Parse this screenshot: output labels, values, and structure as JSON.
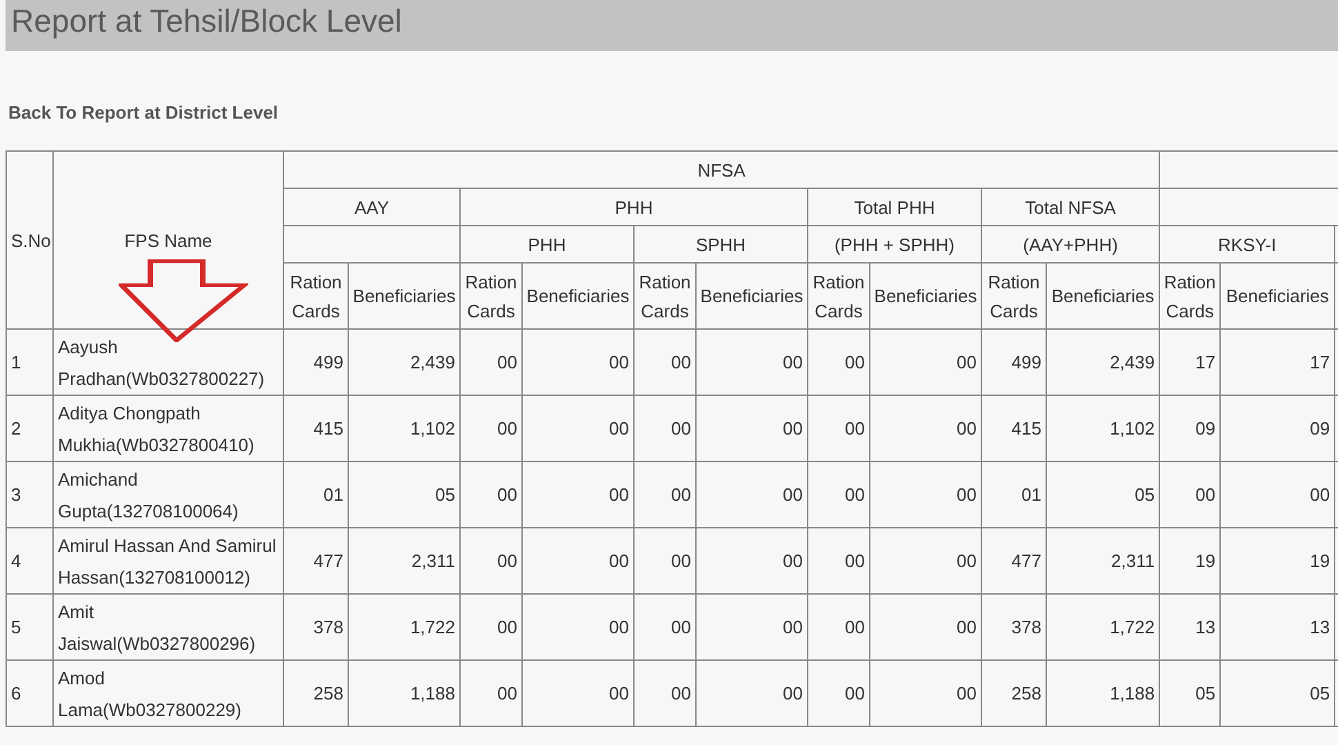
{
  "title": "Report at Tehsil/Block Level",
  "back_link": "Back To Report at District Level",
  "table": {
    "headers": {
      "sno": "S.No",
      "fps_name": "FPS Name",
      "group": "NFSA",
      "subgroups": [
        "AAY",
        "PHH",
        "Total PHH",
        "Total NFSA"
      ],
      "subheaders": [
        "PHH",
        "SPHH",
        "(PHH + SPHH)",
        "(AAY+PHH)",
        "RKSY-I"
      ],
      "leaf": [
        "Ration Cards",
        "Beneficiaries",
        "Ration Cards",
        "Beneficiaries",
        "Ration Cards",
        "Beneficiaries",
        "Ration Cards",
        "Beneficiaries",
        "Ration Cards",
        "Beneficiaries",
        "Ration Cards",
        "Beneficiaries"
      ]
    },
    "rows": [
      {
        "sno": "1",
        "fps_name": "Aayush Pradhan(Wb0327800227)",
        "values": [
          "499",
          "2,439",
          "00",
          "00",
          "00",
          "00",
          "00",
          "00",
          "499",
          "2,439",
          "17",
          "17"
        ]
      },
      {
        "sno": "2",
        "fps_name": "Aditya Chongpath Mukhia(Wb0327800410)",
        "values": [
          "415",
          "1,102",
          "00",
          "00",
          "00",
          "00",
          "00",
          "00",
          "415",
          "1,102",
          "09",
          "09"
        ]
      },
      {
        "sno": "3",
        "fps_name": "Amichand Gupta(132708100064)",
        "values": [
          "01",
          "05",
          "00",
          "00",
          "00",
          "00",
          "00",
          "00",
          "01",
          "05",
          "00",
          "00"
        ]
      },
      {
        "sno": "4",
        "fps_name": "Amirul Hassan And Samirul Hassan(132708100012)",
        "values": [
          "477",
          "2,311",
          "00",
          "00",
          "00",
          "00",
          "00",
          "00",
          "477",
          "2,311",
          "19",
          "19"
        ]
      },
      {
        "sno": "5",
        "fps_name": "Amit Jaiswal(Wb0327800296)",
        "values": [
          "378",
          "1,722",
          "00",
          "00",
          "00",
          "00",
          "00",
          "00",
          "378",
          "1,722",
          "13",
          "13"
        ]
      },
      {
        "sno": "6",
        "fps_name": "Amod Lama(Wb0327800229)",
        "values": [
          "258",
          "1,188",
          "00",
          "00",
          "00",
          "00",
          "00",
          "00",
          "258",
          "1,188",
          "05",
          "05"
        ]
      }
    ]
  }
}
